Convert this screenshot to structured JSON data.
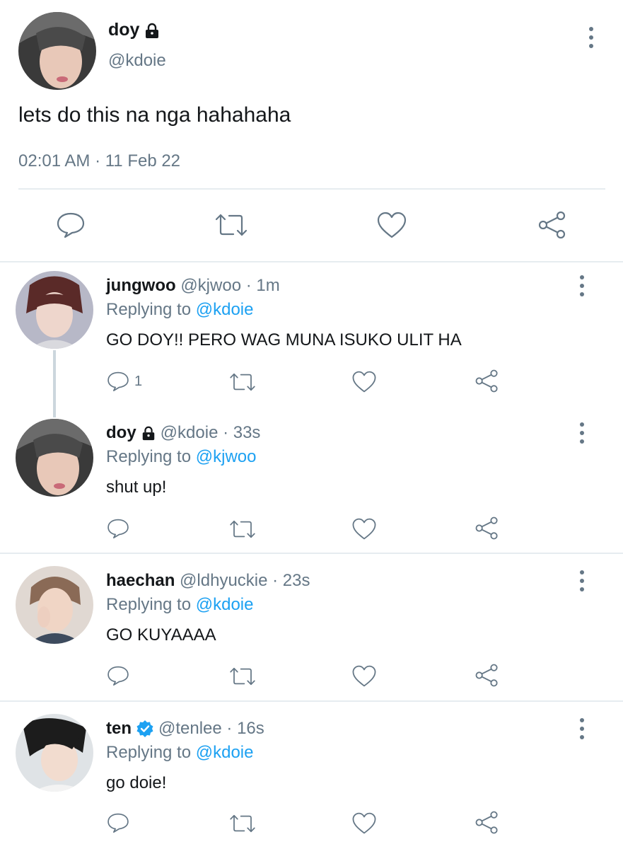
{
  "main_tweet": {
    "display_name": "doy",
    "handle": "@kdoie",
    "text": "lets do this na nga hahahaha",
    "timestamp": "02:01 AM · 11 Feb 22",
    "icons": [
      "reply-icon",
      "retweet-icon",
      "like-icon",
      "share-icon"
    ]
  },
  "replies": [
    {
      "display_name": "jungwoo",
      "handle_time": "@kjwoo · 1m",
      "replying_label": "Replying to",
      "replying_to": "@kdoie",
      "text": "GO DOY!! PERO WAG MUNA ISUKO ULIT HA",
      "reply_count": "1"
    },
    {
      "display_name": "doy",
      "handle_time": "@kdoie · 33s",
      "replying_label": "Replying to",
      "replying_to": "@kjwoo",
      "text": "shut up!",
      "reply_count": ""
    },
    {
      "display_name": "haechan",
      "handle_time": "@ldhyuckie · 23s",
      "replying_label": "Replying to",
      "replying_to": "@kdoie",
      "text": "GO KUYAAAA",
      "reply_count": ""
    },
    {
      "display_name": "ten",
      "handle_time": "@tenlee · 16s",
      "replying_label": "Replying to",
      "replying_to": "@kdoie",
      "text": "go doie!",
      "reply_count": ""
    }
  ],
  "colors": {
    "link": "#1da1f2",
    "muted": "#657786",
    "verified": "#1da1f2",
    "divider": "#e6ecf0"
  }
}
